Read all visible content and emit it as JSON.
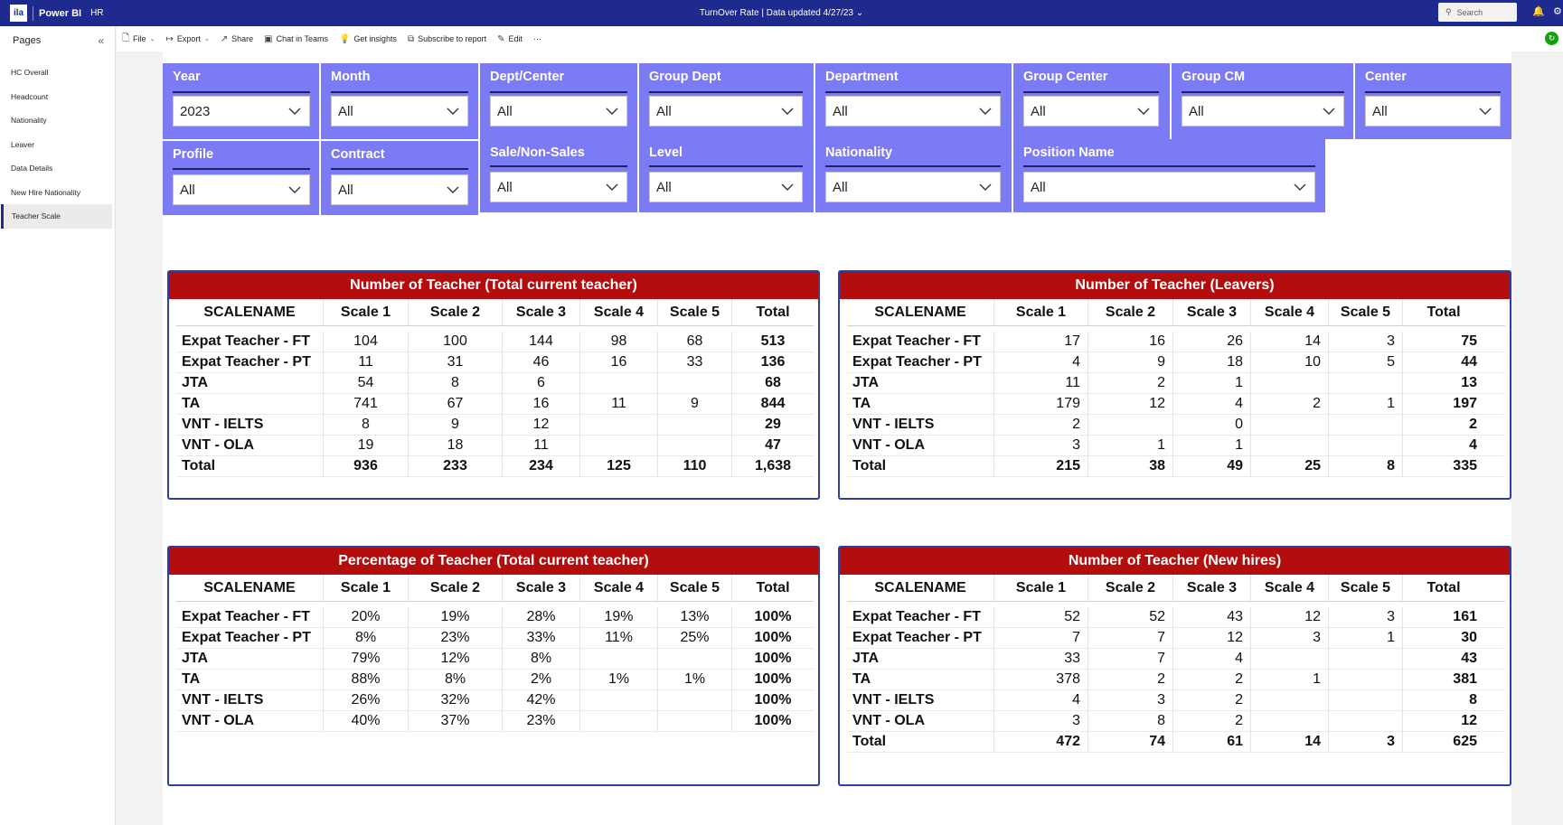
{
  "topbar": {
    "logo_text": "ila",
    "app_name": "Power BI",
    "workspace": "HR",
    "report_title": "TurnOver Rate",
    "data_updated": "Data updated 4/27/23",
    "search_placeholder": "Search"
  },
  "pages": {
    "title": "Pages",
    "items": [
      {
        "label": "HC Overall"
      },
      {
        "label": "Headcount"
      },
      {
        "label": "Nationality"
      },
      {
        "label": "Leaver"
      },
      {
        "label": "Data Details"
      },
      {
        "label": "New Hire Nationality"
      },
      {
        "label": "Teacher Scale"
      }
    ],
    "active": "Teacher Scale"
  },
  "commands": {
    "file": "File",
    "export": "Export",
    "share": "Share",
    "chat": "Chat in Teams",
    "insights": "Get insights",
    "subscribe": "Subscribe to report",
    "edit": "Edit",
    "more": "···"
  },
  "slicers": {
    "year": {
      "label": "Year",
      "value": "2023"
    },
    "month": {
      "label": "Month",
      "value": "All"
    },
    "dept_center": {
      "label": "Dept/Center",
      "value": "All"
    },
    "group_dept": {
      "label": "Group Dept",
      "value": "All"
    },
    "department": {
      "label": "Department",
      "value": "All"
    },
    "group_center": {
      "label": "Group Center",
      "value": "All"
    },
    "group_cm": {
      "label": "Group CM",
      "value": "All"
    },
    "center": {
      "label": "Center",
      "value": "All"
    },
    "profile": {
      "label": "Profile",
      "value": "All"
    },
    "contract": {
      "label": "Contract",
      "value": "All"
    },
    "sale": {
      "label": "Sale/Non-Sales",
      "value": "All"
    },
    "level": {
      "label": "Level",
      "value": "All"
    },
    "nationality": {
      "label": "Nationality",
      "value": "All"
    },
    "position": {
      "label": "Position Name",
      "value": "All"
    }
  },
  "tables": {
    "current": {
      "title": "Number of Teacher (Total current teacher)",
      "headers": [
        "SCALENAME",
        "Scale 1",
        "Scale 2",
        "Scale 3",
        "Scale 4",
        "Scale 5",
        "Total"
      ],
      "rows": [
        [
          "Expat Teacher - FT",
          "104",
          "100",
          "144",
          "98",
          "68",
          "513"
        ],
        [
          "Expat Teacher - PT",
          "11",
          "31",
          "46",
          "16",
          "33",
          "136"
        ],
        [
          "JTA",
          "54",
          "8",
          "6",
          "",
          "",
          "68"
        ],
        [
          "TA",
          "741",
          "67",
          "16",
          "11",
          "9",
          "844"
        ],
        [
          "VNT - IELTS",
          "8",
          "9",
          "12",
          "",
          "",
          "29"
        ],
        [
          "VNT - OLA",
          "19",
          "18",
          "11",
          "",
          "",
          "47"
        ],
        [
          "Total",
          "936",
          "233",
          "234",
          "125",
          "110",
          "1,638"
        ]
      ]
    },
    "leavers": {
      "title": "Number of Teacher (Leavers)",
      "headers": [
        "SCALENAME",
        "Scale 1",
        "Scale 2",
        "Scale 3",
        "Scale 4",
        "Scale 5",
        "Total"
      ],
      "rows": [
        [
          "Expat Teacher - FT",
          "17",
          "16",
          "26",
          "14",
          "3",
          "75"
        ],
        [
          "Expat Teacher - PT",
          "4",
          "9",
          "18",
          "10",
          "5",
          "44"
        ],
        [
          "JTA",
          "11",
          "2",
          "1",
          "",
          "",
          "13"
        ],
        [
          "TA",
          "179",
          "12",
          "4",
          "2",
          "1",
          "197"
        ],
        [
          "VNT - IELTS",
          "2",
          "",
          "0",
          "",
          "",
          "2"
        ],
        [
          "VNT - OLA",
          "3",
          "1",
          "1",
          "",
          "",
          "4"
        ],
        [
          "Total",
          "215",
          "38",
          "49",
          "25",
          "8",
          "335"
        ]
      ]
    },
    "percentage": {
      "title": "Percentage of Teacher (Total current teacher)",
      "headers": [
        "SCALENAME",
        "Scale 1",
        "Scale 2",
        "Scale 3",
        "Scale 4",
        "Scale 5",
        "Total"
      ],
      "rows": [
        [
          "Expat Teacher - FT",
          "20%",
          "19%",
          "28%",
          "19%",
          "13%",
          "100%"
        ],
        [
          "Expat Teacher - PT",
          "8%",
          "23%",
          "33%",
          "11%",
          "25%",
          "100%"
        ],
        [
          "JTA",
          "79%",
          "12%",
          "8%",
          "",
          "",
          "100%"
        ],
        [
          "TA",
          "88%",
          "8%",
          "2%",
          "1%",
          "1%",
          "100%"
        ],
        [
          "VNT - IELTS",
          "26%",
          "32%",
          "42%",
          "",
          "",
          "100%"
        ],
        [
          "VNT - OLA",
          "40%",
          "37%",
          "23%",
          "",
          "",
          "100%"
        ]
      ]
    },
    "newhires": {
      "title": "Number of Teacher (New hires)",
      "headers": [
        "SCALENAME",
        "Scale 1",
        "Scale 2",
        "Scale 3",
        "Scale 4",
        "Scale 5",
        "Total"
      ],
      "rows": [
        [
          "Expat Teacher - FT",
          "52",
          "52",
          "43",
          "12",
          "3",
          "161"
        ],
        [
          "Expat Teacher - PT",
          "7",
          "7",
          "12",
          "3",
          "1",
          "30"
        ],
        [
          "JTA",
          "33",
          "7",
          "4",
          "",
          "",
          "43"
        ],
        [
          "TA",
          "378",
          "2",
          "2",
          "1",
          "",
          "381"
        ],
        [
          "VNT - IELTS",
          "4",
          "3",
          "2",
          "",
          "",
          "8"
        ],
        [
          "VNT - OLA",
          "3",
          "8",
          "2",
          "",
          "",
          "12"
        ],
        [
          "Total",
          "472",
          "74",
          "61",
          "14",
          "3",
          "625"
        ]
      ]
    }
  }
}
